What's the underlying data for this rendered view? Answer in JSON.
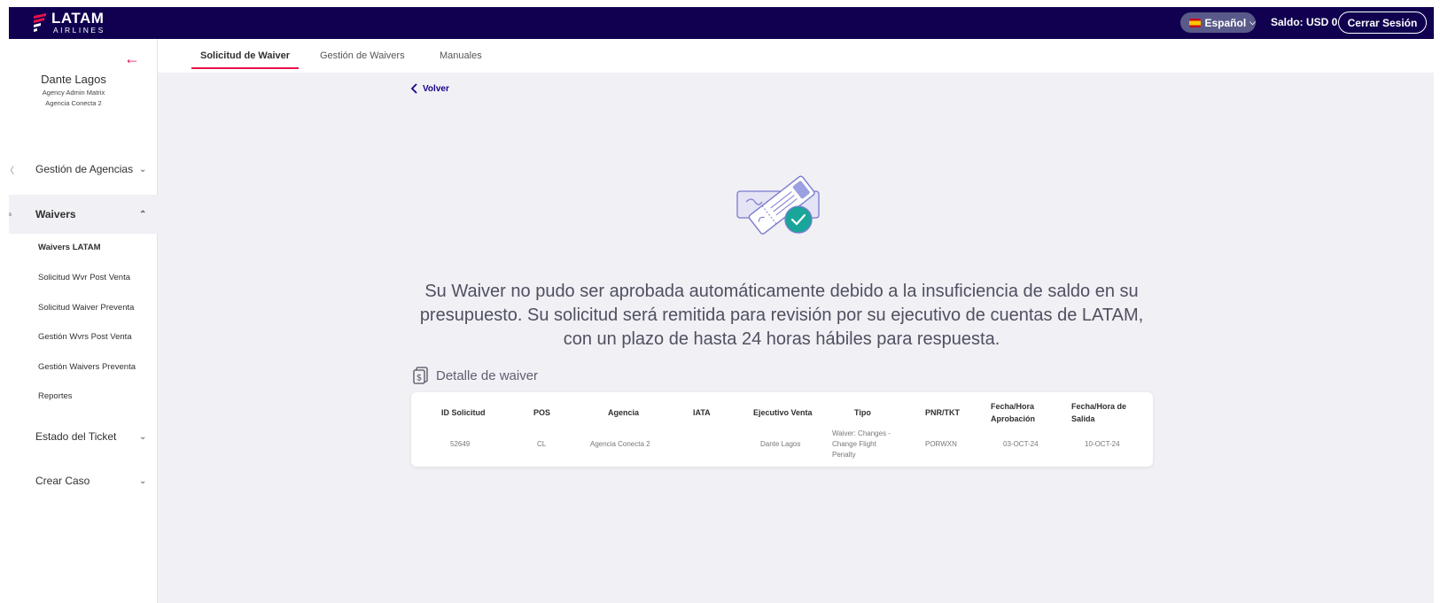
{
  "header": {
    "logo_text": "LATAM",
    "logo_sub": "AIRLINES",
    "language": "Español",
    "balance": "Saldo: USD 0",
    "logout": "Cerrar Sesión"
  },
  "user": {
    "name": "Dante Lagos",
    "role": "Agency Admin Matrix",
    "agency": "Agencia Conecta 2"
  },
  "sidebar": {
    "menus": [
      {
        "label": "Gestión de Agencias"
      },
      {
        "label": "Waivers"
      },
      {
        "label": "Estado del Ticket"
      },
      {
        "label": "Crear Caso"
      }
    ],
    "waivers_items": [
      {
        "label": "Waivers LATAM"
      },
      {
        "label": "Solicitud Wvr Post Venta"
      },
      {
        "label": "Solicitud Waiver Preventa"
      },
      {
        "label": "Gestión Wvrs Post Venta"
      },
      {
        "label": "Gestión Waivers Preventa"
      },
      {
        "label": "Reportes"
      }
    ]
  },
  "tabs": [
    {
      "label": "Solicitud de Waiver"
    },
    {
      "label": "Gestión de Waivers"
    },
    {
      "label": "Manuales"
    }
  ],
  "main": {
    "back_label": "Volver",
    "message": "Su Waiver no pudo ser aprobada automáticamente debido a la insuficiencia de saldo en su presupuesto. Su solicitud será remitida para revisión por su ejecutivo de cuentas de LATAM, con un plazo de hasta 24 horas hábiles para respuesta.",
    "detail_title": "Detalle de waiver"
  },
  "table": {
    "headers": [
      "ID Solicitud",
      "POS",
      "Agencia",
      "IATA",
      "Ejecutivo Venta",
      "Tipo",
      "PNR/TKT",
      "Fecha/Hora Aprobación",
      "Fecha/Hora de Salida"
    ],
    "row": [
      "52649",
      "CL",
      "Agencia Conecta 2",
      "",
      "Dante Lagos",
      "Waiver: Changes - Change Flight Penalty",
      "PORWXN",
      "03-OCT-24",
      "10-OCT-24"
    ]
  },
  "colors": {
    "navy": "#10004f",
    "accent_red": "#e8114b",
    "link_blue": "#1b0088",
    "success_teal": "#1aa59a"
  }
}
